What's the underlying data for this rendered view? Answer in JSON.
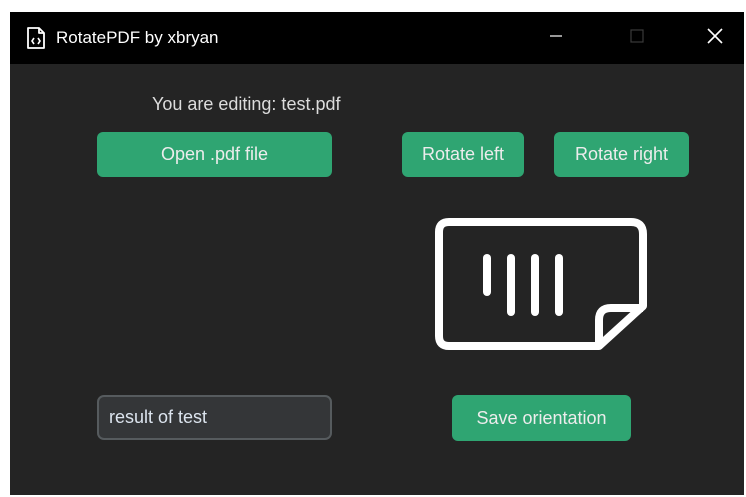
{
  "window": {
    "title": "RotatePDF by xbryan",
    "icon": "pdf-file-icon",
    "controls": {
      "minimize_icon": "minimize-icon",
      "maximize_icon": "maximize-icon",
      "close_icon": "close-icon"
    }
  },
  "editor": {
    "editing_label": "You are editing: test.pdf"
  },
  "buttons": {
    "open_file": "Open .pdf file",
    "rotate_left": "Rotate left",
    "rotate_right": "Rotate right",
    "save_orientation": "Save orientation"
  },
  "output": {
    "filename_value": "result of test"
  },
  "preview": {
    "icon": "rotated-document-icon"
  },
  "colors": {
    "background": "#242424",
    "titlebar": "#000000",
    "accent": "#2fa572",
    "text": "#dcdcdc",
    "input_bg": "#343638",
    "input_border": "#565b5e"
  }
}
